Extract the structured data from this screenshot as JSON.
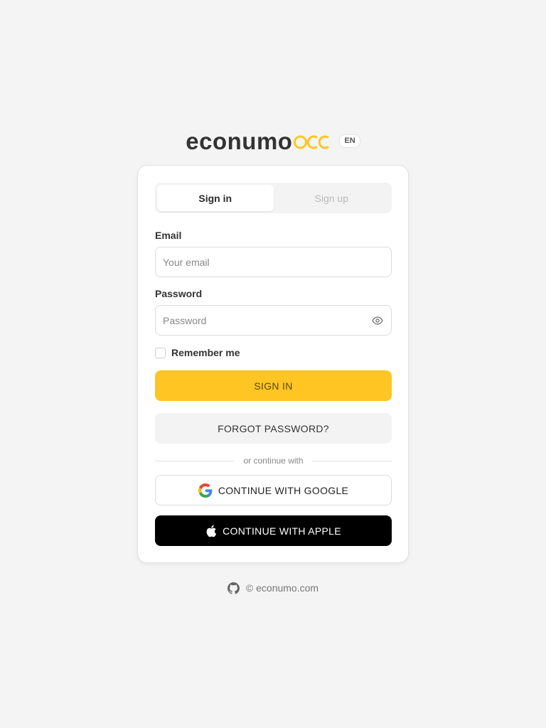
{
  "brand": {
    "logo_text": "econumo",
    "language": "EN",
    "accent_color": "#fec523"
  },
  "tabs": [
    {
      "label": "Sign in",
      "active": true
    },
    {
      "label": "Sign up",
      "active": false
    }
  ],
  "form": {
    "email_label": "Email",
    "email_placeholder": "Your email",
    "email_value": "",
    "password_label": "Password",
    "password_placeholder": "Password",
    "password_value": "",
    "remember_label": "Remember me",
    "remember_checked": false
  },
  "buttons": {
    "sign_in": "SIGN IN",
    "forgot_password": "FORGOT PASSWORD?",
    "divider_text": "or continue with",
    "google": "CONTINUE WITH GOOGLE",
    "apple": "CONTINUE WITH APPLE"
  },
  "icons": {
    "password_toggle": "eye-icon",
    "google": "google-icon",
    "apple": "apple-icon",
    "footer": "github-icon"
  },
  "footer": {
    "text": "© econumo.com"
  }
}
